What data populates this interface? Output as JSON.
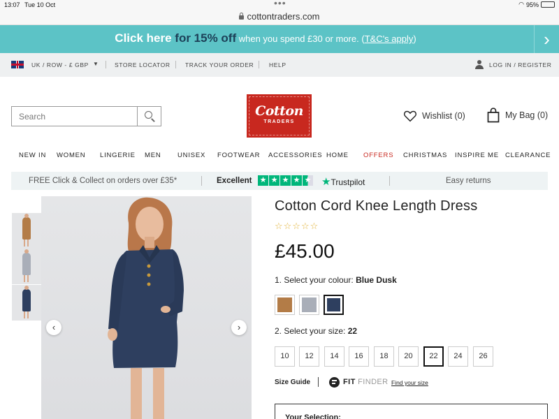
{
  "status_bar": {
    "time": "13:07",
    "date": "Tue 10 Oct",
    "battery": "95%"
  },
  "browser": {
    "url": "cottontraders.com"
  },
  "promo": {
    "part1": "Click here",
    "part2": " for 15% off",
    "part3": " when you spend £30 or more. (",
    "tc": "T&C's apply",
    "part4": ")"
  },
  "utility_nav": {
    "region": "UK / ROW - £ GBP",
    "store_locator": "STORE LOCATOR",
    "track_order": "TRACK YOUR ORDER",
    "help": "HELP",
    "login": "LOG IN / REGISTER"
  },
  "header": {
    "search_placeholder": "Search",
    "logo_line1": "Cotton",
    "logo_line2": "TRADERS",
    "wishlist": "Wishlist (0)",
    "bag": "My Bag (0)"
  },
  "main_nav": [
    "NEW IN",
    "WOMEN",
    "LINGERIE",
    "MEN",
    "UNISEX",
    "FOOTWEAR",
    "ACCESSORIES",
    "HOME",
    "OFFERS",
    "CHRISTMAS",
    "INSPIRE ME",
    "CLEARANCE"
  ],
  "trust_bar": {
    "click_collect": "FREE Click & Collect on orders over £35*",
    "excellent": "Excellent",
    "trustpilot": "Trustpilot",
    "returns": "Easy returns"
  },
  "product": {
    "title": "Cotton Cord Knee Length Dress",
    "rating_stars": "☆☆☆☆☆",
    "price": "£45.00",
    "colour_prompt": "1. Select your colour: ",
    "colour_selected": "Blue Dusk",
    "colours": [
      {
        "name": "tan",
        "hex": "#b37c47"
      },
      {
        "name": "grey",
        "hex": "#a9aeb8"
      },
      {
        "name": "blue-dusk",
        "hex": "#2e3f5f"
      }
    ],
    "size_prompt": "2. Select your size: ",
    "size_selected": "22",
    "sizes": [
      "10",
      "12",
      "14",
      "16",
      "18",
      "20",
      "22",
      "24",
      "26"
    ],
    "size_guide": "Size Guide",
    "fit_bold": "FIT",
    "fit_light": " FINDER",
    "find_your_size": "Find your size",
    "your_selection": "Your Selection:"
  },
  "colors": {
    "teal": "#5cc3c6",
    "navy": "#1c3f57",
    "brand_red": "#c8281f",
    "trustpilot_green": "#00b67a"
  }
}
